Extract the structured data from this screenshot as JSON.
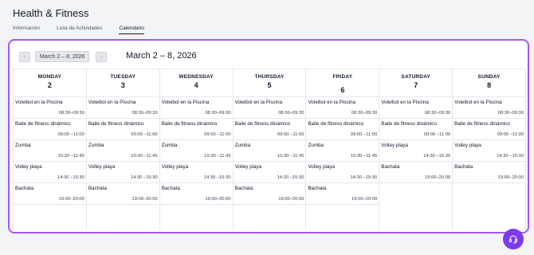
{
  "app": {
    "title": "Health & Fitness"
  },
  "tabs": [
    {
      "label": "Información",
      "active": false
    },
    {
      "label": "Lista de Actividades",
      "active": false
    },
    {
      "label": "Calendario",
      "active": true
    }
  ],
  "calendar": {
    "prev_icon": "chevron-left-icon",
    "next_icon": "chevron-right-icon",
    "range_pill": "March 2 – 8, 2026",
    "range_title": "March 2 – 8, 2026",
    "days": [
      {
        "name": "MONDAY",
        "num": "2",
        "events": [
          {
            "name": "Voleibol en la Piscina",
            "time": "08:30–09:30"
          },
          {
            "name": "Baile de fitness dinámico",
            "time": "09:00 –11:00"
          },
          {
            "name": "Zumba",
            "time": "10:30 –11:45"
          },
          {
            "name": "Volley playa",
            "time": "14:30 –15:30"
          },
          {
            "name": "Bachata",
            "time": "19:00–20:00"
          }
        ]
      },
      {
        "name": "TUESDAY",
        "num": "3",
        "events": [
          {
            "name": "Voleibol en la Piscina",
            "time": "08:30–09:30"
          },
          {
            "name": "Baile de fitness dinámico",
            "time": "09:00 –11:00"
          },
          {
            "name": "Zumba",
            "time": "10:30 –11:45"
          },
          {
            "name": "Volley playa",
            "time": "14:30 –15:30"
          },
          {
            "name": "Bachata",
            "time": "19:00–20:00"
          }
        ]
      },
      {
        "name": "WEDNESDAY",
        "num": "4",
        "events": [
          {
            "name": "Voleibol en la Piscina",
            "time": "08:30–09:30"
          },
          {
            "name": "Baile de fitness dinámico",
            "time": "09:00 –11:00"
          },
          {
            "name": "Zumba",
            "time": "10:30 –11:45"
          },
          {
            "name": "Volley playa",
            "time": "14:30 –15:30"
          },
          {
            "name": "Bachata",
            "time": "19:00–20:00"
          }
        ]
      },
      {
        "name": "THURSDAY",
        "num": "5",
        "events": [
          {
            "name": "Voleibol en la Piscina",
            "time": "08:30–09:30"
          },
          {
            "name": "Baile de fitness dinámico",
            "time": "09:00 –11:00"
          },
          {
            "name": "Zumba",
            "time": "10:30 –11:45"
          },
          {
            "name": "Volley playa",
            "time": "14:30 –15:30"
          },
          {
            "name": "Bachata",
            "time": "19:00–20:00"
          }
        ]
      },
      {
        "name": "FRIDAY",
        "num": "6",
        "events": [
          {
            "name": "Voleibol en la Piscina",
            "time": "08:30–09:30"
          },
          {
            "name": "Baile de fitness dinámico",
            "time": "09:00 –11:00"
          },
          {
            "name": "Zumba",
            "time": "10:30 –11:45"
          },
          {
            "name": "Volley playa",
            "time": "14:30 –15:30"
          },
          {
            "name": "Bachata",
            "time": "19:00–20:00"
          }
        ]
      },
      {
        "name": "SATURDAY",
        "num": "7",
        "events": [
          {
            "name": "Voleibol en la Piscina",
            "time": "08:30–09:30"
          },
          {
            "name": "Baile de fitness dinámico",
            "time": "09:00 –11:00"
          },
          {
            "name": "Volley playa",
            "time": "14:30 –15:30"
          },
          {
            "name": "Bachata",
            "time": "19:00–20:00"
          }
        ]
      },
      {
        "name": "SUNDAY",
        "num": "8",
        "events": [
          {
            "name": "Voleibol en la Piscina",
            "time": "08:30–09:30"
          },
          {
            "name": "Baile de fitness dinámico",
            "time": "09:00 –11:00"
          },
          {
            "name": "Volley playa",
            "time": "14:30 –15:30"
          },
          {
            "name": "Bachata",
            "time": "19:00–20:00"
          }
        ]
      }
    ]
  },
  "help": {
    "icon": "headset-icon"
  },
  "colors": {
    "accent": "#a855f7",
    "fab": "#7c3aed"
  }
}
